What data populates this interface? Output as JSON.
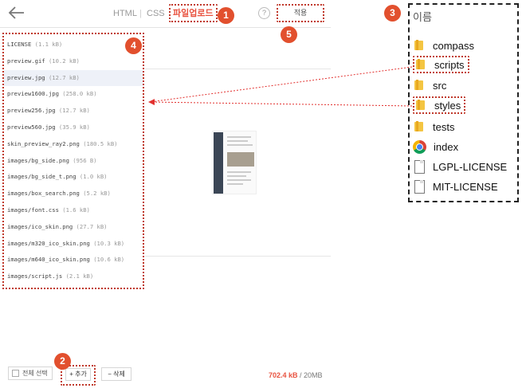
{
  "topbar": {
    "tabs": [
      {
        "label": "HTML"
      },
      {
        "label": "CSS"
      },
      {
        "label": "파일업로드"
      }
    ],
    "separator": "|",
    "help_label": "?",
    "apply_label": "적용"
  },
  "badges": [
    "1",
    "2",
    "3",
    "4",
    "5"
  ],
  "files": [
    {
      "name": "LICENSE",
      "size": "(1.1 kB)"
    },
    {
      "name": "preview.gif",
      "size": "(10.2 kB)"
    },
    {
      "name": "preview.jpg",
      "size": "(12.7 kB)"
    },
    {
      "name": "preview1600.jpg",
      "size": "(258.0 kB)"
    },
    {
      "name": "preview256.jpg",
      "size": "(12.7 kB)"
    },
    {
      "name": "preview560.jpg",
      "size": "(35.9 kB)"
    },
    {
      "name": "skin_preview_ray2.png",
      "size": "(180.5 kB)"
    },
    {
      "name": "images/bg_side.png",
      "size": "(956 B)"
    },
    {
      "name": "images/bg_side_t.png",
      "size": "(1.0 kB)"
    },
    {
      "name": "images/box_search.png",
      "size": "(5.2 kB)"
    },
    {
      "name": "images/font.css",
      "size": "(1.6 kB)"
    },
    {
      "name": "images/ico_skin.png",
      "size": "(27.7 kB)"
    },
    {
      "name": "images/m320_ico_skin.png",
      "size": "(10.3 kB)"
    },
    {
      "name": "images/m640_ico_skin.png",
      "size": "(10.6 kB)"
    },
    {
      "name": "images/script.js",
      "size": "(2.1 kB)"
    }
  ],
  "bottombar": {
    "select_all_label": "전체 선택",
    "add_label": "+ 추가",
    "delete_label": "− 삭제",
    "quota_used": "702.4 kB",
    "quota_total": " / 20MB"
  },
  "explorer": {
    "header": "이름",
    "items": [
      {
        "name": "compass",
        "icon": "folder-icon"
      },
      {
        "name": "scripts",
        "icon": "folder-icon"
      },
      {
        "name": "src",
        "icon": "folder-icon"
      },
      {
        "name": "styles",
        "icon": "folder-icon"
      },
      {
        "name": "tests",
        "icon": "folder-icon"
      },
      {
        "name": "index",
        "icon": "chrome-icon"
      },
      {
        "name": "LGPL-LICENSE",
        "icon": "document-icon"
      },
      {
        "name": "MIT-LICENSE",
        "icon": "document-icon"
      }
    ]
  },
  "colors": {
    "accent": "#e8523f",
    "badge": "#e2502e",
    "highlight_border": "#c0392b"
  }
}
